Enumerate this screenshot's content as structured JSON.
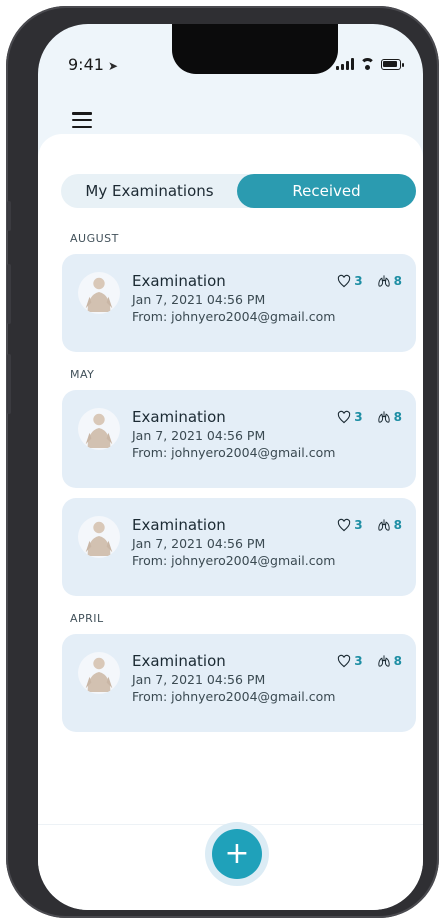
{
  "status": {
    "time": "9:41"
  },
  "tabs": {
    "my": "My Examinations",
    "received": "Received"
  },
  "sections": [
    {
      "title": "AUGUST",
      "items": [
        {
          "title": "Examination",
          "date": "Jan 7, 2021 04:56 PM",
          "from": "From: johnyero2004@gmail.com",
          "heart": "3",
          "lungs": "8"
        }
      ]
    },
    {
      "title": "MAY",
      "items": [
        {
          "title": "Examination",
          "date": "Jan 7, 2021 04:56 PM",
          "from": "From: johnyero2004@gmail.com",
          "heart": "3",
          "lungs": "8"
        },
        {
          "title": "Examination",
          "date": "Jan 7, 2021 04:56 PM",
          "from": "From: johnyero2004@gmail.com",
          "heart": "3",
          "lungs": "8"
        }
      ]
    },
    {
      "title": "APRIL",
      "items": [
        {
          "title": "Examination",
          "date": "Jan 7, 2021 04:56 PM",
          "from": "From: johnyero2004@gmail.com",
          "heart": "3",
          "lungs": "8"
        }
      ]
    }
  ],
  "icons": {
    "menu": "menu-icon",
    "heart": "heart-icon",
    "lungs": "lungs-icon",
    "add": "plus-icon"
  },
  "colors": {
    "accent": "#2b9bb0",
    "card": "#e4eef7"
  },
  "fab": {
    "label": "+"
  }
}
